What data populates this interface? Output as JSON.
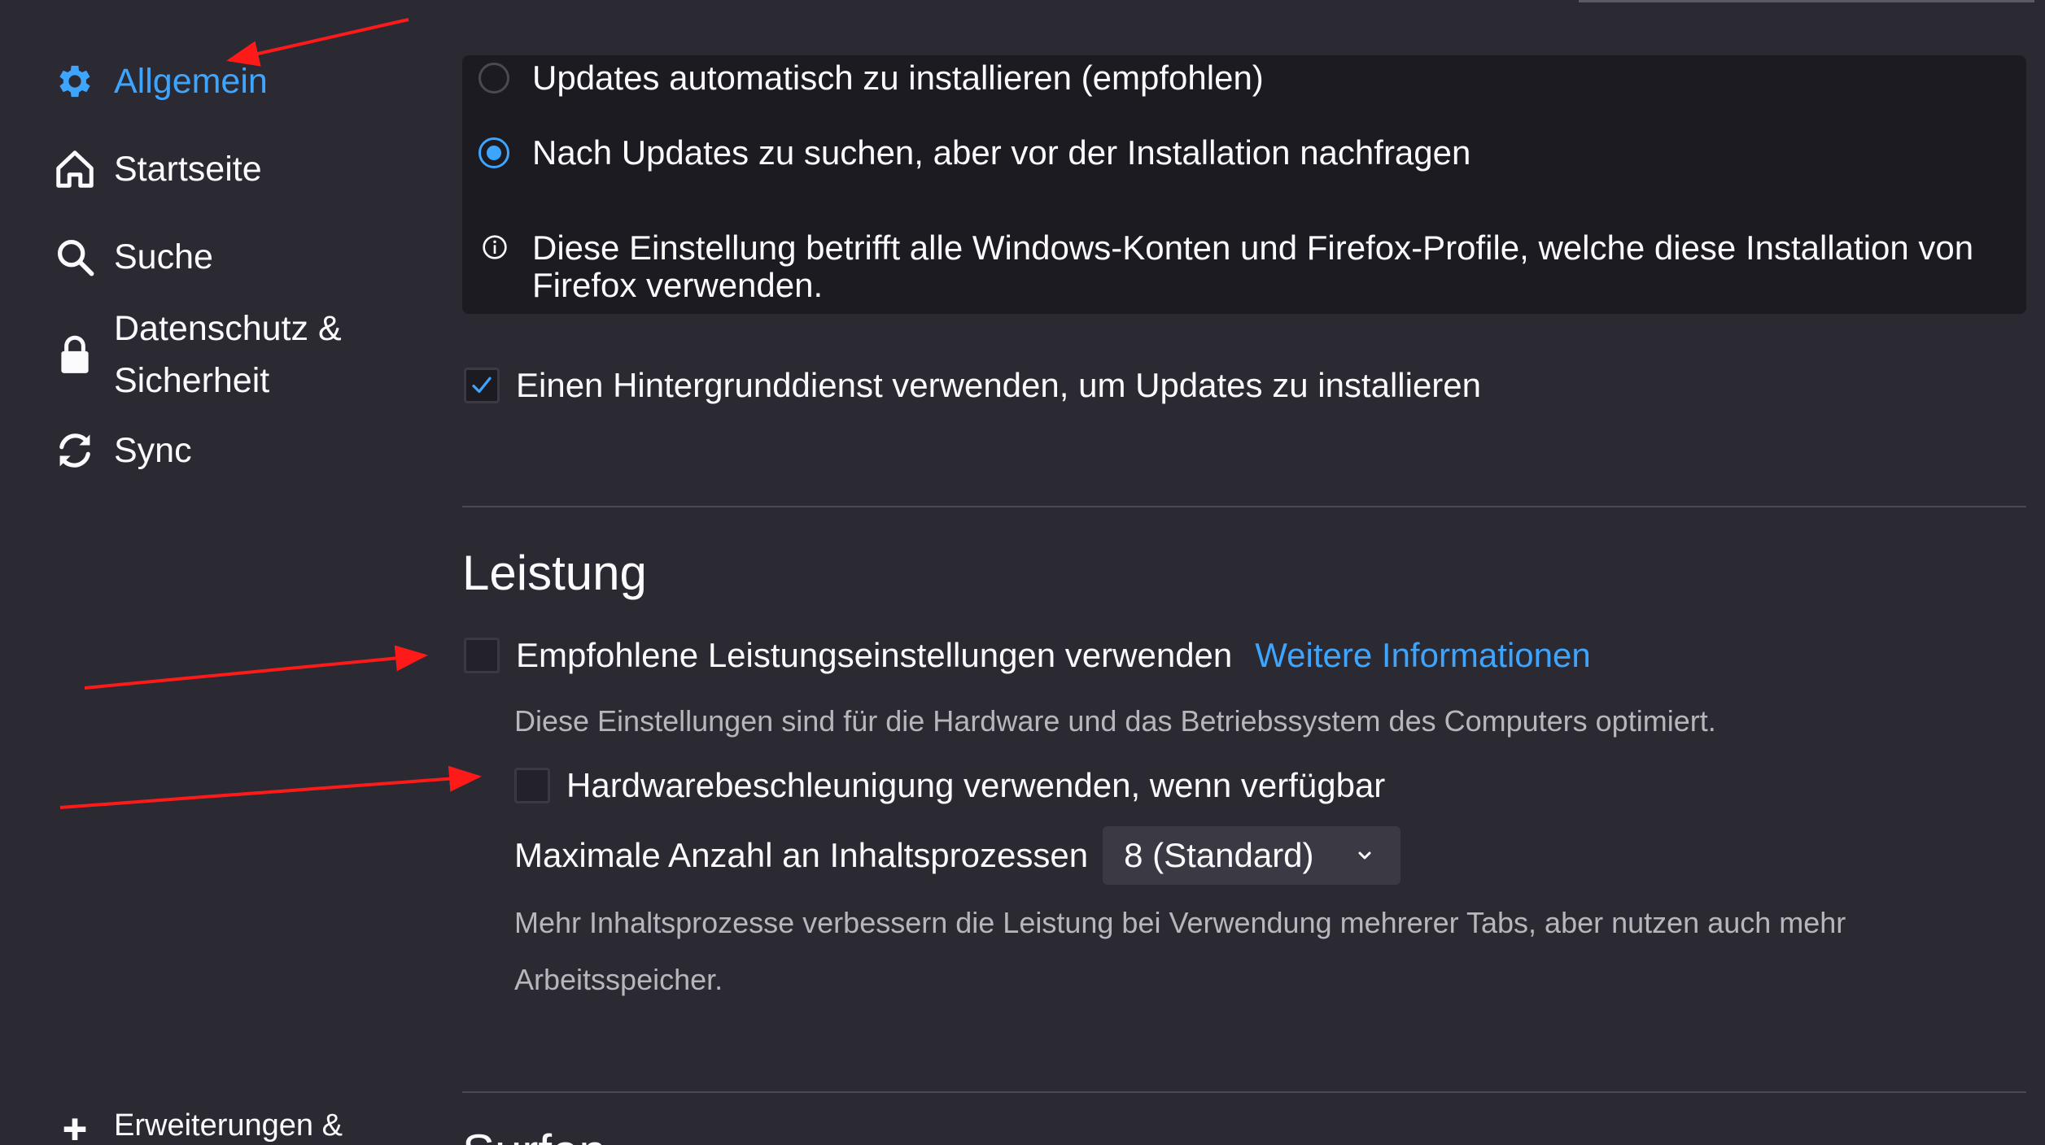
{
  "sidebar": {
    "items": [
      {
        "label": "Allgemein",
        "icon": "gear-icon",
        "selected": true
      },
      {
        "label": "Startseite",
        "icon": "home-icon"
      },
      {
        "label": "Suche",
        "icon": "search-icon"
      },
      {
        "label": "Datenschutz & Sicherheit",
        "icon": "lock-icon"
      },
      {
        "label": "Sync",
        "icon": "sync-icon"
      },
      {
        "label": "Erweiterungen &",
        "icon": "puzzle-icon"
      }
    ]
  },
  "updates": {
    "option_auto": "Updates automatisch zu installieren (empfohlen)",
    "option_ask": "Nach Updates zu suchen, aber vor der Installation nachfragen",
    "selected": "ask",
    "info": "Diese Einstellung betrifft alle Windows-Konten und Firefox-Profile, welche diese Installation von Firefox verwenden.",
    "background_service": "Einen Hintergrunddienst verwenden, um Updates zu installieren",
    "background_service_checked": true
  },
  "performance": {
    "title": "Leistung",
    "recommended_label": "Empfohlene Leistungseinstellungen verwenden",
    "recommended_checked": false,
    "learn_more": "Weitere Informationen",
    "recommended_desc": "Diese Einstellungen sind für die Hardware und das Betriebssystem des Computers optimiert.",
    "hw_accel_label": "Hardwarebeschleunigung verwenden, wenn verfügbar",
    "hw_accel_checked": false,
    "process_label": "Maximale Anzahl an Inhaltsprozessen",
    "process_value": "8 (Standard)",
    "process_desc": "Mehr Inhaltsprozesse verbessern die Leistung bei Verwendung mehrerer Tabs, aber nutzen auch mehr Arbeitsspeicher."
  },
  "next_section_title": "Surfen",
  "colors": {
    "accent": "#3ea5ff",
    "background": "#2b2a33",
    "annotation_arrow": "#ff1a1a"
  }
}
